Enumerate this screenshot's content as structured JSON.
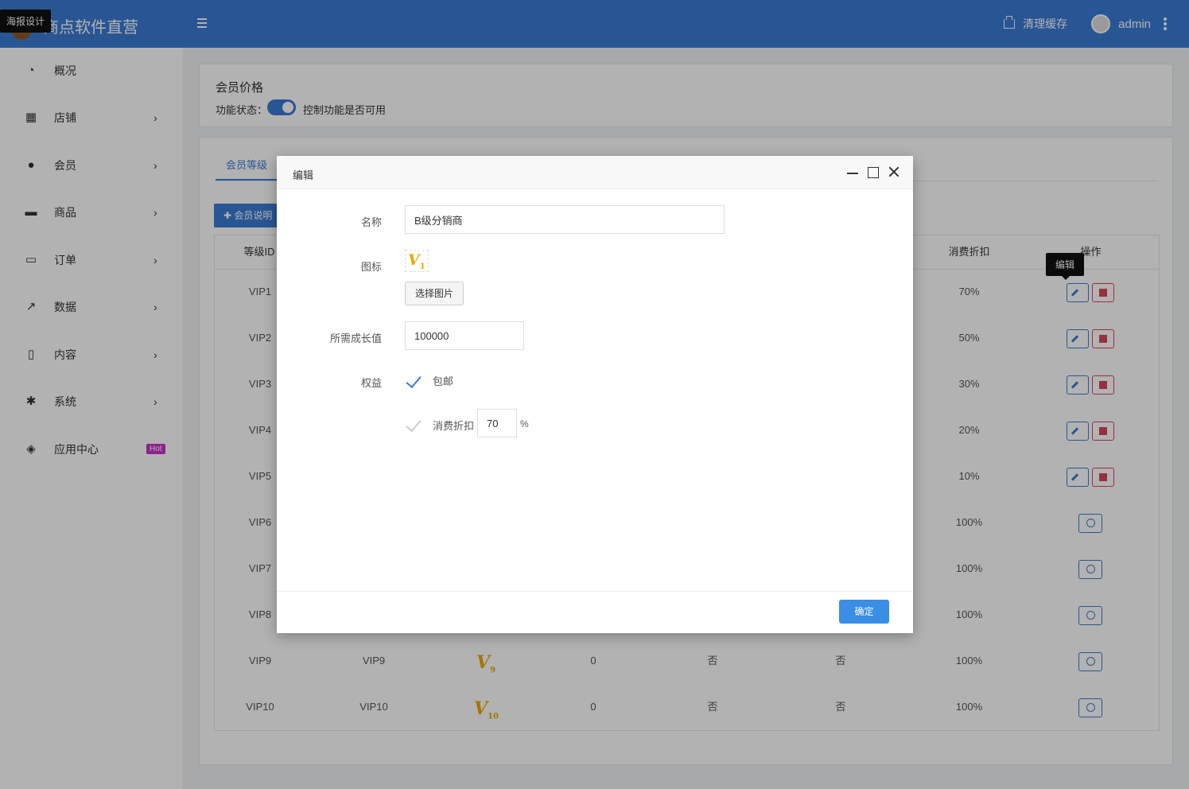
{
  "header": {
    "brand_name": "商点软件直营",
    "tooltip": "海报设计",
    "clear_cache": "清理缓存",
    "user": "admin"
  },
  "sidebar": {
    "items": [
      {
        "label": "概况",
        "icon": "dashboard-icon"
      },
      {
        "label": "店铺",
        "icon": "grid-icon"
      },
      {
        "label": "会员",
        "icon": "users-icon"
      },
      {
        "label": "商品",
        "icon": "cart-icon"
      },
      {
        "label": "订单",
        "icon": "money-icon"
      },
      {
        "label": "数据",
        "icon": "chart-icon"
      },
      {
        "label": "内容",
        "icon": "document-icon"
      },
      {
        "label": "系统",
        "icon": "gear-icon"
      },
      {
        "label": "应用中心",
        "icon": "cube-icon",
        "badge": "Hot"
      }
    ]
  },
  "card1": {
    "title": "会员价格",
    "status_label": "功能状态：",
    "status_desc": "控制功能是否可用",
    "enabled": true
  },
  "tabs": {
    "active": "会员等级"
  },
  "explain_button": "会员说明",
  "table": {
    "headers": {
      "id": "等级ID",
      "discount": "消费折扣",
      "action": "操作"
    },
    "rows": [
      {
        "id": "VIP1",
        "discount": "70%"
      },
      {
        "id": "VIP2",
        "discount": "50%"
      },
      {
        "id": "VIP3",
        "discount": "30%"
      },
      {
        "id": "VIP4",
        "discount": "20%"
      },
      {
        "id": "VIP5",
        "discount": "10%"
      },
      {
        "id": "VIP6",
        "discount": "100%"
      },
      {
        "id": "VIP7",
        "discount": "100%"
      },
      {
        "id": "VIP8",
        "discount": "100%"
      },
      {
        "id": "VIP9",
        "name": "VIP9",
        "icon_num": "9",
        "growth": "0",
        "free_ship": "否",
        "discount_enabled": "否",
        "discount": "100%"
      },
      {
        "id": "VIP10",
        "name": "VIP10",
        "icon_num": "10",
        "growth": "0",
        "free_ship": "否",
        "discount_enabled": "否",
        "discount": "100%"
      }
    ],
    "edit_tooltip": "编辑"
  },
  "modal": {
    "title": "编辑",
    "name_label": "名称",
    "name_value": "B级分销商",
    "icon_label": "图标",
    "icon_num": "1",
    "choose_image": "选择图片",
    "growth_label": "所需成长值",
    "growth_value": "100000",
    "benefit_label": "权益",
    "free_shipping": "包邮",
    "free_shipping_checked": true,
    "discount_label": "消费折扣",
    "discount_checked": false,
    "discount_value": "70",
    "percent": "%",
    "ok": "确定"
  }
}
